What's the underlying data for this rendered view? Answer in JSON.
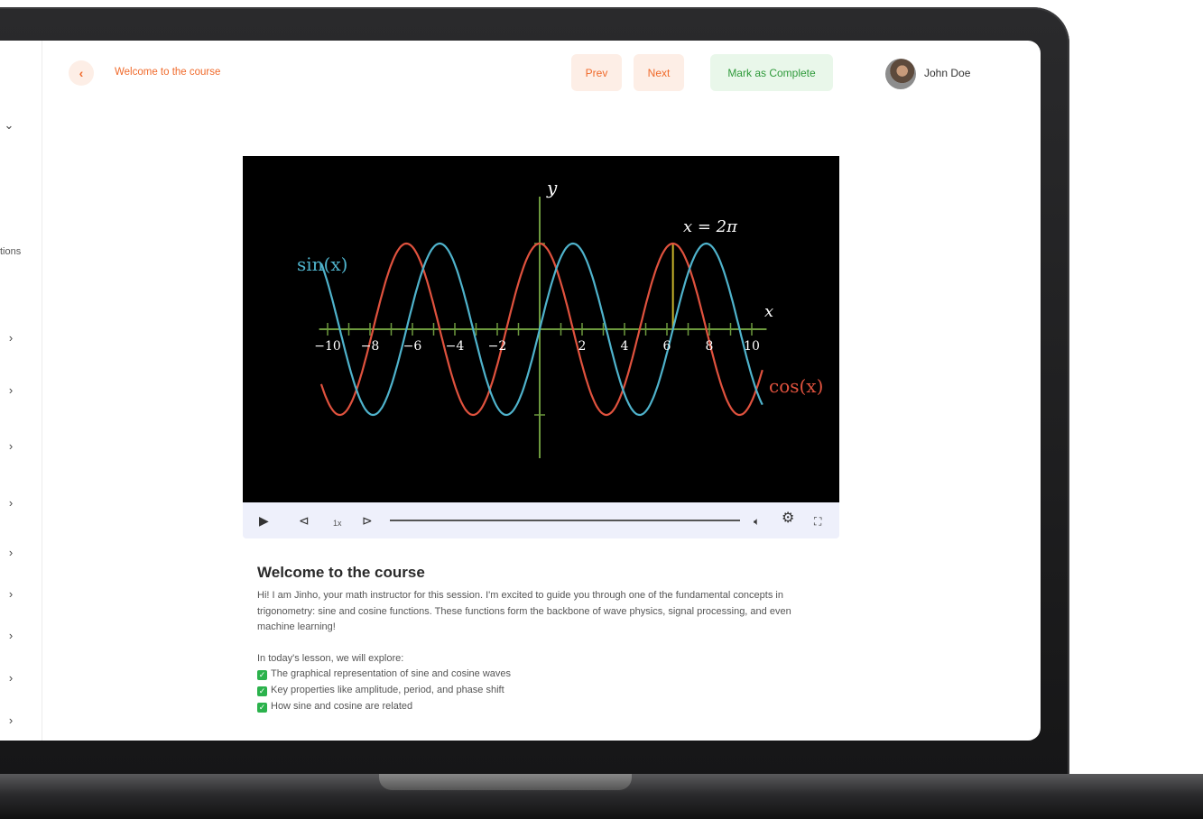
{
  "header": {
    "breadcrumb": "Welcome to the course",
    "prev_label": "Prev",
    "next_label": "Next",
    "complete_label": "Mark as Complete",
    "user_name": "John Doe"
  },
  "sidebar": {
    "partial_text": "tions",
    "chevron_count": 10
  },
  "video": {
    "labels": {
      "y_axis": "y",
      "x_axis": "x",
      "sin": "sin(x)",
      "cos": "cos(x)",
      "marker": "x = 2π"
    },
    "ticks": [
      "−10",
      "−8",
      "−6",
      "−4",
      "−2",
      "2",
      "4",
      "6",
      "8",
      "10"
    ],
    "speed_label": "1x",
    "progress": 0
  },
  "content": {
    "title": "Welcome to the course",
    "intro": "Hi! I am Jinho, your math instructor for this session. I'm excited to guide you through one of the fundamental concepts in trigonometry: sine and cosine functions. These functions form the backbone of wave physics, signal processing, and even machine learning!",
    "lead": "In today's lesson, we will explore:",
    "bullets": [
      "The graphical representation of sine and cosine waves",
      "Key properties like amplitude, period, and phase shift",
      "How sine and cosine are related"
    ]
  },
  "colors": {
    "accent": "#f06a2b",
    "success": "#2f9a3b",
    "sin_color": "#4fb3cc",
    "cos_color": "#e0523e",
    "axis_color": "#6d9a3e"
  }
}
